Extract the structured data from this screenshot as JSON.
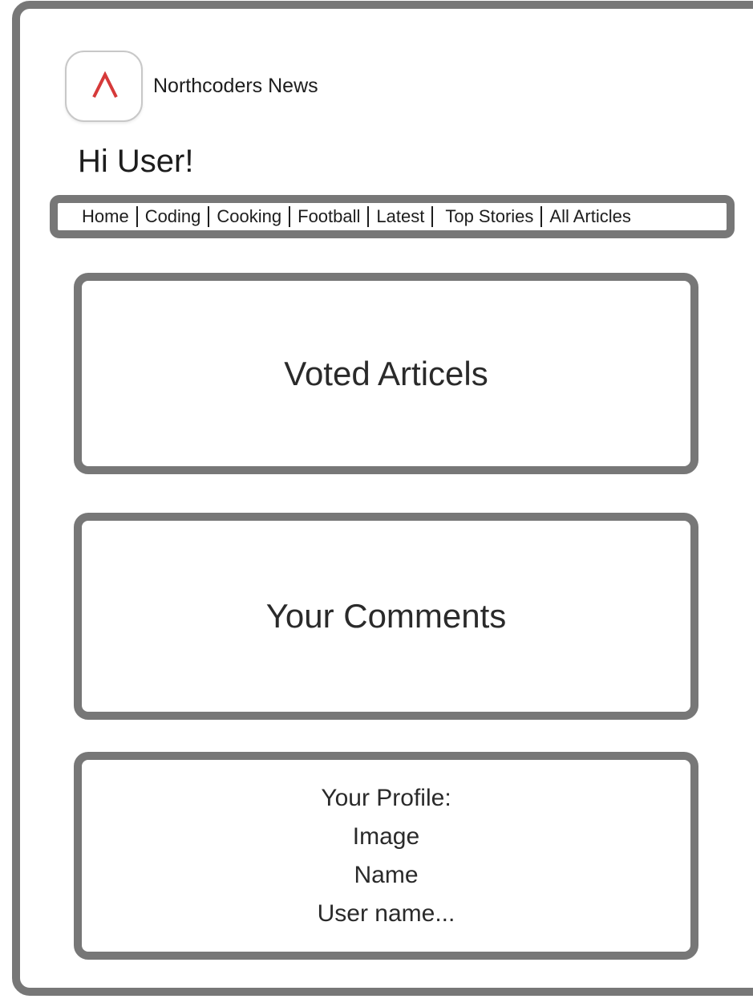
{
  "header": {
    "site_name": "Northcoders News",
    "greeting": "Hi User!",
    "logo_icon": "chevron-up-icon",
    "logo_color": "#d63a3a"
  },
  "nav": {
    "items": [
      {
        "label": "Home"
      },
      {
        "label": "Coding"
      },
      {
        "label": "Cooking"
      },
      {
        "label": "Football"
      },
      {
        "label": "Latest"
      },
      {
        "label": "Top Stories"
      },
      {
        "label": "All Articles"
      }
    ]
  },
  "sections": {
    "voted_articles": {
      "title": "Voted Articels"
    },
    "comments": {
      "title": "Your Comments"
    },
    "profile": {
      "lines": [
        "Your Profile:",
        "Image",
        "Name",
        "User name..."
      ]
    }
  },
  "colors": {
    "border": "#777777",
    "text": "#1d1d1d"
  }
}
